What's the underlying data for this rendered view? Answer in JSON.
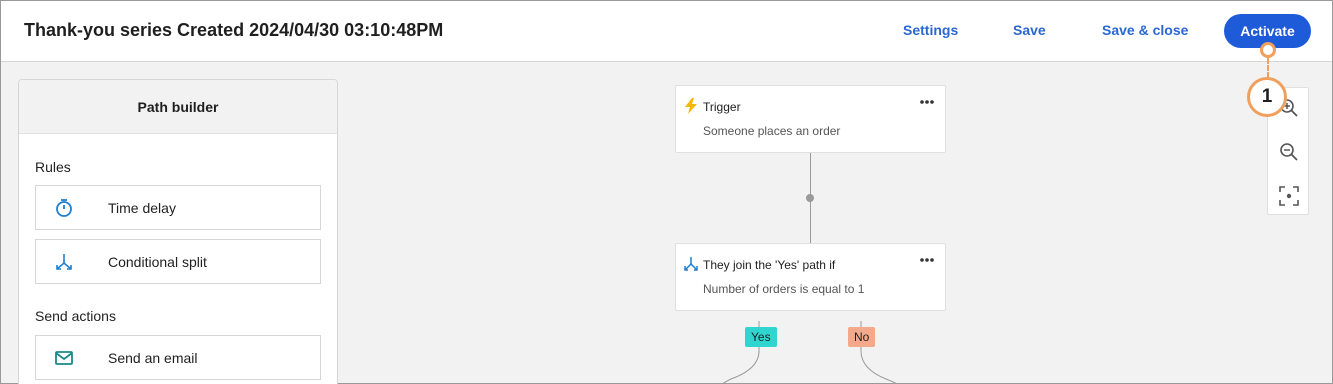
{
  "header": {
    "title": "Thank-you series Created 2024/04/30 03:10:48PM",
    "settings_label": "Settings",
    "save_label": "Save",
    "save_close_label": "Save & close",
    "activate_label": "Activate"
  },
  "callout": {
    "number": "1"
  },
  "sidebar": {
    "title": "Path builder",
    "rules_heading": "Rules",
    "rules": [
      {
        "label": "Time delay",
        "icon": "stopwatch-icon"
      },
      {
        "label": "Conditional split",
        "icon": "split-icon"
      }
    ],
    "send_heading": "Send actions",
    "send": [
      {
        "label": "Send an email",
        "icon": "envelope-icon"
      }
    ]
  },
  "canvas": {
    "trigger": {
      "title": "Trigger",
      "subtitle": "Someone places an order",
      "icon": "lightning-icon"
    },
    "condition": {
      "title": "They join the 'Yes' path if",
      "subtitle": "Number of orders is equal to 1",
      "icon": "split-icon"
    },
    "yes_label": "Yes",
    "no_label": "No"
  },
  "zoom": {
    "zoom_in": "zoom-in-icon",
    "zoom_out": "zoom-out-icon",
    "fit": "fit-to-screen-icon"
  },
  "colors": {
    "accent": "#1e5bd8",
    "link": "#2b67d1",
    "callout": "#f0a05c",
    "yes_tag": "#2fd6d0",
    "no_tag": "#f4a98a",
    "icon_teal": "#1a8a8a",
    "icon_yellow": "#f5b800"
  }
}
